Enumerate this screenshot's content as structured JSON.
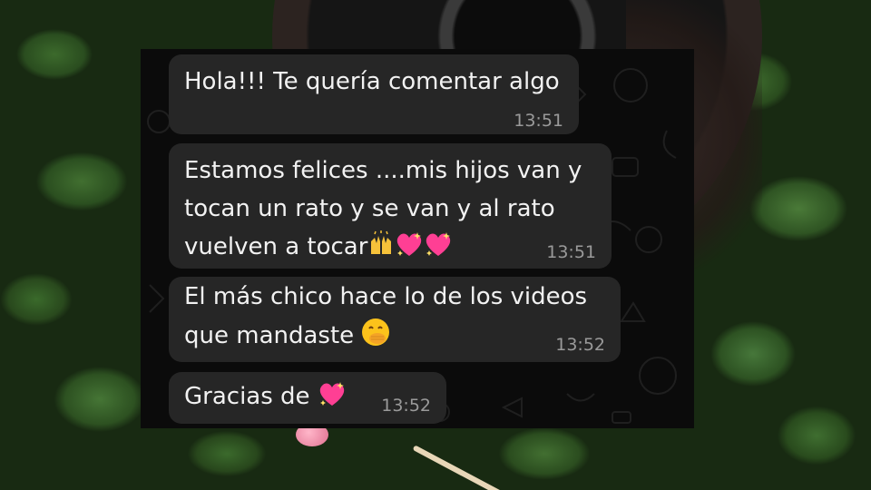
{
  "messages": [
    {
      "text_lines": [
        "Hola!!! Te quería comentar algo"
      ],
      "time": "13:51"
    },
    {
      "text_lines": [
        "Estamos felices ....mis hijos van y",
        "tocan un rato y se van y al rato",
        "vuelven a tocar"
      ],
      "emojis": [
        "raising-hands",
        "sparkling-heart",
        "sparkling-heart"
      ],
      "time": "13:51"
    },
    {
      "text_lines": [
        "El más chico hace lo de los videos",
        "que mandaste"
      ],
      "emojis": [
        "face-with-hand-over-mouth"
      ],
      "time": "13:52"
    },
    {
      "text_lines": [
        "Gracias de"
      ],
      "emojis": [
        "sparkling-heart"
      ],
      "time": "13:52"
    }
  ],
  "colors": {
    "bubble": "#262626",
    "chat_background": "#0b0b0b",
    "text": "#f2f2f2",
    "timestamp": "#9a9a9a"
  }
}
